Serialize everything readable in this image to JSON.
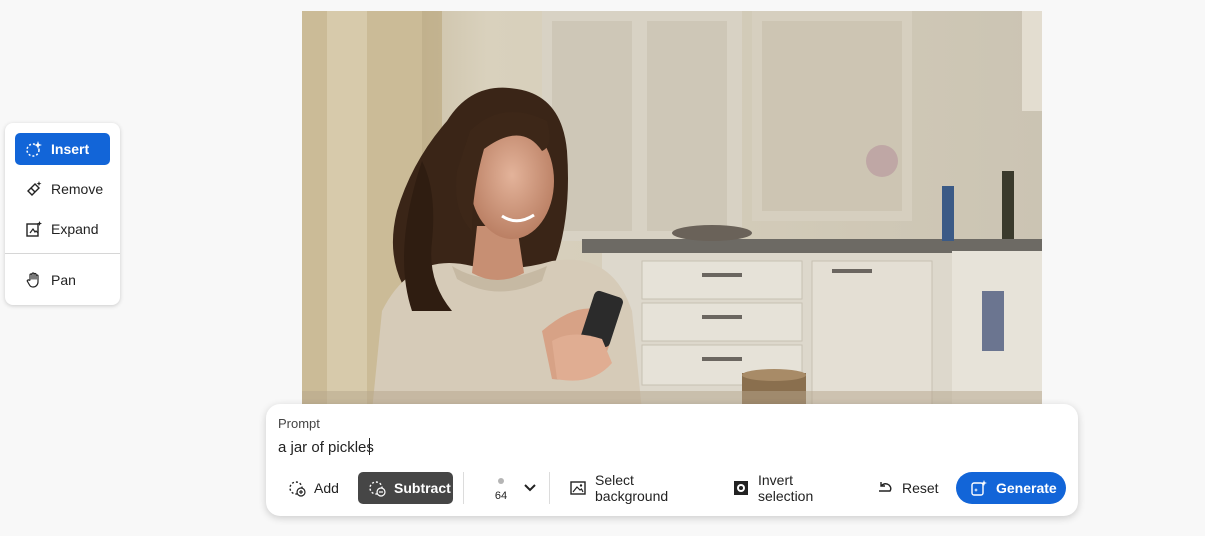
{
  "tools": {
    "items": [
      {
        "label": "Insert",
        "icon": "insert-sparkle-icon",
        "active": true
      },
      {
        "label": "Remove",
        "icon": "eraser-icon",
        "active": false
      },
      {
        "label": "Expand",
        "icon": "expand-icon",
        "active": false
      },
      {
        "label": "Pan",
        "icon": "hand-icon",
        "active": false
      }
    ]
  },
  "prompt": {
    "label": "Prompt",
    "value": "a jar of pickles"
  },
  "toolbar": {
    "add_label": "Add",
    "subtract_label": "Subtract",
    "brush_size": "64",
    "select_background_label": "Select background",
    "invert_selection_label": "Invert selection",
    "reset_label": "Reset",
    "generate_label": "Generate"
  },
  "colors": {
    "accent": "#1265d8",
    "active_dark": "#464646",
    "background": "#f8f8f8"
  }
}
